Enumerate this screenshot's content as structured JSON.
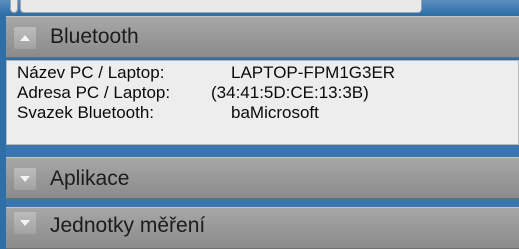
{
  "sections": [
    {
      "title": "Bluetooth",
      "expanded": true
    },
    {
      "title": "Aplikace",
      "expanded": false
    },
    {
      "title": "Jednotky měření",
      "expanded": false
    }
  ],
  "bluetooth_info": [
    {
      "key": "Název PC / Laptop:",
      "value": "LAPTOP-FPM1G3ER"
    },
    {
      "key": "Adresa PC / Laptop:",
      "value": "(34:41:5D:CE:13:3B)"
    },
    {
      "key": "Svazek Bluetooth:",
      "value": "baMicrosoft"
    }
  ],
  "icons": {
    "expanded": "chevron-up-icon",
    "collapsed": "chevron-down-icon"
  }
}
